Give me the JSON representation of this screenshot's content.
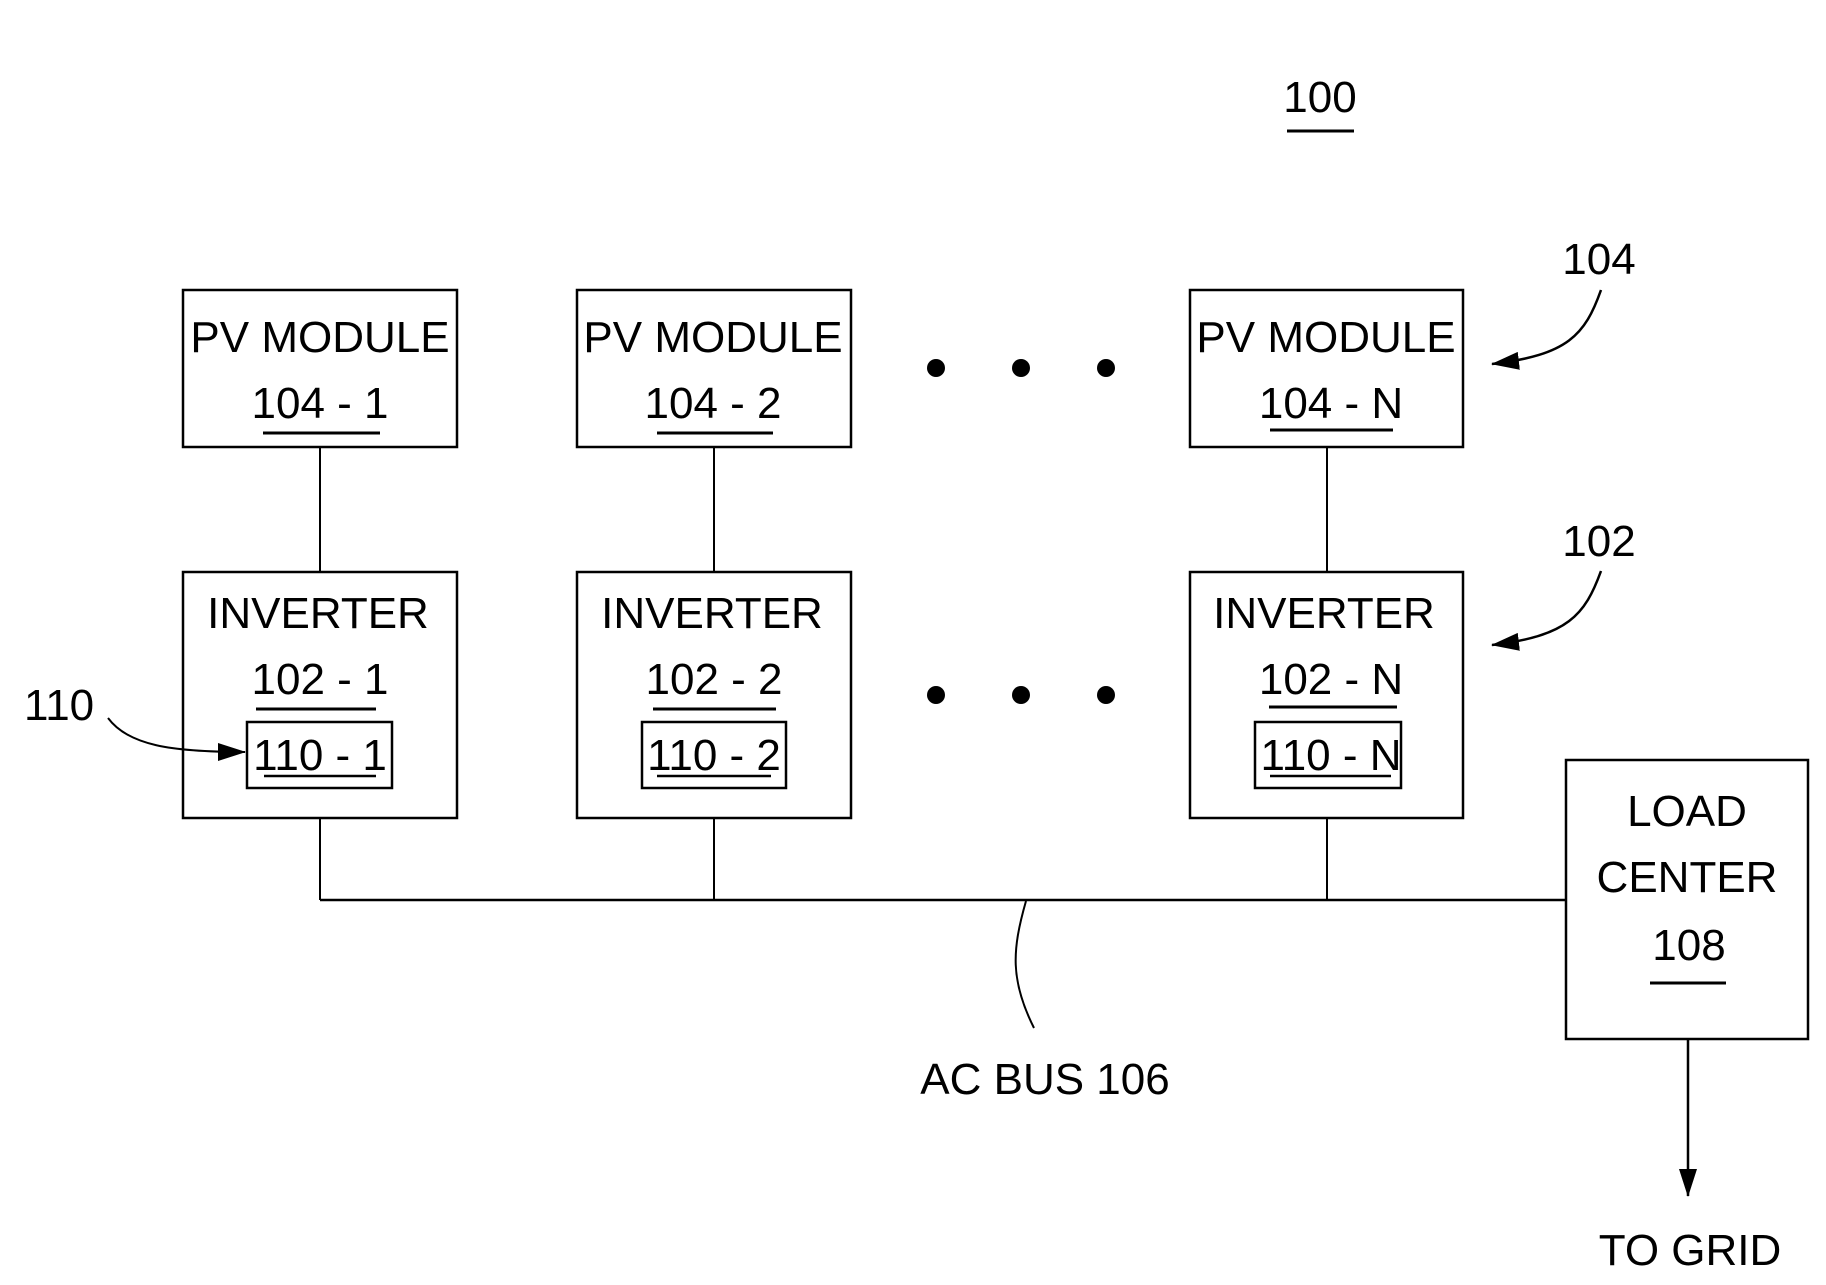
{
  "figure": {
    "ref": "100",
    "pv_modules": [
      {
        "title": "PV MODULE",
        "ref": "104 - 1"
      },
      {
        "title": "PV MODULE",
        "ref": "104 - 2"
      },
      {
        "title": "PV MODULE",
        "ref": "104 - N"
      }
    ],
    "inverters": [
      {
        "title": "INVERTER",
        "ref": "102 - 1",
        "sub_ref": "110 - 1"
      },
      {
        "title": "INVERTER",
        "ref": "102 - 2",
        "sub_ref": "110 - 2"
      },
      {
        "title": "INVERTER",
        "ref": "102 - N",
        "sub_ref": "110 - N"
      }
    ],
    "callouts": {
      "pv_group": "104",
      "inverter_group": "102",
      "sub_group": "110"
    },
    "load_center": {
      "line1": "LOAD",
      "line2": "CENTER",
      "ref": "108"
    },
    "bus_label": "AC BUS 106",
    "grid_label": "TO GRID",
    "ellipsis_icon": "three-dots"
  }
}
